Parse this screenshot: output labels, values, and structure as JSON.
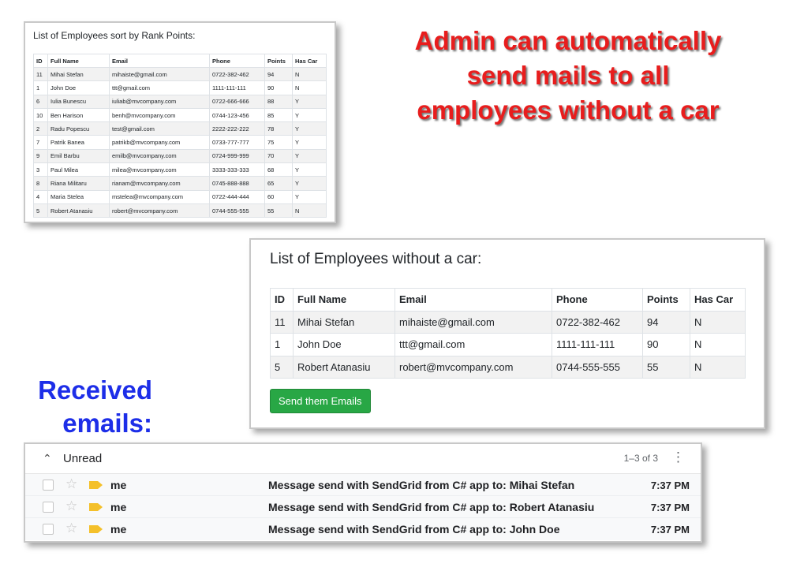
{
  "rank_panel": {
    "title": "List of Employees sort by Rank Points:",
    "columns": [
      "ID",
      "Full Name",
      "Email",
      "Phone",
      "Points",
      "Has Car"
    ],
    "rows": [
      [
        "11",
        "Mihai Stefan",
        "mihaiste@gmail.com",
        "0722-382-462",
        "94",
        "N"
      ],
      [
        "1",
        "John Doe",
        "ttt@gmail.com",
        "1111-111-111",
        "90",
        "N"
      ],
      [
        "6",
        "Iulia Bunescu",
        "iuliab@mvcompany.com",
        "0722-666-666",
        "88",
        "Y"
      ],
      [
        "10",
        "Ben Harison",
        "benh@mvcompany.com",
        "0744-123-456",
        "85",
        "Y"
      ],
      [
        "2",
        "Radu Popescu",
        "test@gmail.com",
        "2222-222-222",
        "78",
        "Y"
      ],
      [
        "7",
        "Patrik Banea",
        "patrikb@mvcompany.com",
        "0733-777-777",
        "75",
        "Y"
      ],
      [
        "9",
        "Emil Barbu",
        "emilb@mvcompany.com",
        "0724-999-999",
        "70",
        "Y"
      ],
      [
        "3",
        "Paul Milea",
        "milea@mvcompany.com",
        "3333-333-333",
        "68",
        "Y"
      ],
      [
        "8",
        "Riana Militaru",
        "rianam@mvcompany.com",
        "0745-888-888",
        "65",
        "Y"
      ],
      [
        "4",
        "Maria Stelea",
        "mstelea@mvcompany.com",
        "0722-444-444",
        "60",
        "Y"
      ],
      [
        "5",
        "Robert Atanasiu",
        "robert@mvcompany.com",
        "0744-555-555",
        "55",
        "N"
      ]
    ]
  },
  "headline": [
    "Admin can automatically",
    "send mails to all",
    "employees without a car"
  ],
  "nocar_panel": {
    "title": "List of Employees without a car:",
    "columns": [
      "ID",
      "Full Name",
      "Email",
      "Phone",
      "Points",
      "Has Car"
    ],
    "rows": [
      [
        "11",
        "Mihai Stefan",
        "mihaiste@gmail.com",
        "0722-382-462",
        "94",
        "N"
      ],
      [
        "1",
        "John Doe",
        "ttt@gmail.com",
        "1111-111-111",
        "90",
        "N"
      ],
      [
        "5",
        "Robert Atanasiu",
        "robert@mvcompany.com",
        "0744-555-555",
        "55",
        "N"
      ]
    ],
    "send_button": "Send them Emails"
  },
  "received_label": [
    "Received",
    "emails:"
  ],
  "mail": {
    "section": "Unread",
    "count": "1–3 of 3",
    "icons": {
      "collapse": "chevron-up-icon",
      "more": "more-vert-icon",
      "star": "star-icon",
      "important": "important-marker-icon"
    },
    "colors": {
      "send_button": "#28a745",
      "headline": "#e81d1d",
      "received": "#1d2ee8",
      "important": "#f4c02a"
    },
    "rows": [
      {
        "sender": "me",
        "subject": "Message send with SendGrid from C# app to: Mihai Stefan",
        "time": "7:37 PM"
      },
      {
        "sender": "me",
        "subject": "Message send with SendGrid from C# app to: Robert Atanasiu",
        "time": "7:37 PM"
      },
      {
        "sender": "me",
        "subject": "Message send with SendGrid from C# app to: John Doe",
        "time": "7:37 PM"
      }
    ]
  }
}
